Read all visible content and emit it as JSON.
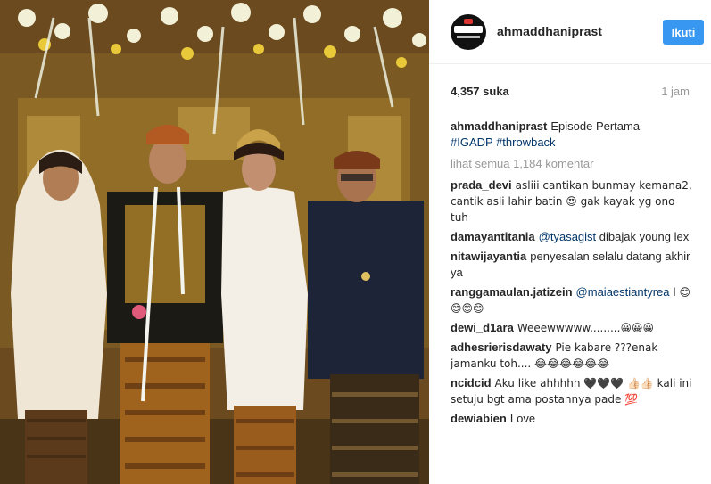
{
  "post": {
    "username": "ahmaddhaniprast",
    "follow_label": "Ikuti",
    "likes": "4,357 suka",
    "time": "1 jam",
    "caption_user": "ahmaddhaniprast",
    "caption_text": "Episode Pertama",
    "hashtag_1": "#IGADP",
    "hashtag_2": "#throwback",
    "view_all": "lihat semua 1,184 komentar"
  },
  "comments": [
    {
      "user": "prada_devi",
      "text": "asliii cantikan bunmay kemana2, cantik asli lahir batin 😍 gak kayak yg ono tuh"
    },
    {
      "user": "damayantitania",
      "mention": "@tyasagist",
      "text": " dibajak young lex"
    },
    {
      "user": "nitawijayantia",
      "text": "penyesalan selalu datang akhir ya"
    },
    {
      "user": "ranggamaulan.jatizein",
      "mention": "@maiaestiantyrea",
      "text": " l 😊😊😊😊"
    },
    {
      "user": "dewi_d1ara",
      "text": "Weeewwwww.........😀😀😀"
    },
    {
      "user": "adhesrierisdawaty",
      "text": "Pie kabare ???enak jamanku toh.... 😂😂😂😂😂😂"
    },
    {
      "user": "ncidcid",
      "text": "Aku like ahhhhh 🖤🖤🖤 👍🏻👍🏻 kali ini setuju bgt ama postannya pade 💯"
    },
    {
      "user": "dewiabien",
      "text": "Love"
    }
  ],
  "colors": {
    "follow_button": "#3897f0",
    "link": "#003569",
    "muted": "#999999"
  }
}
